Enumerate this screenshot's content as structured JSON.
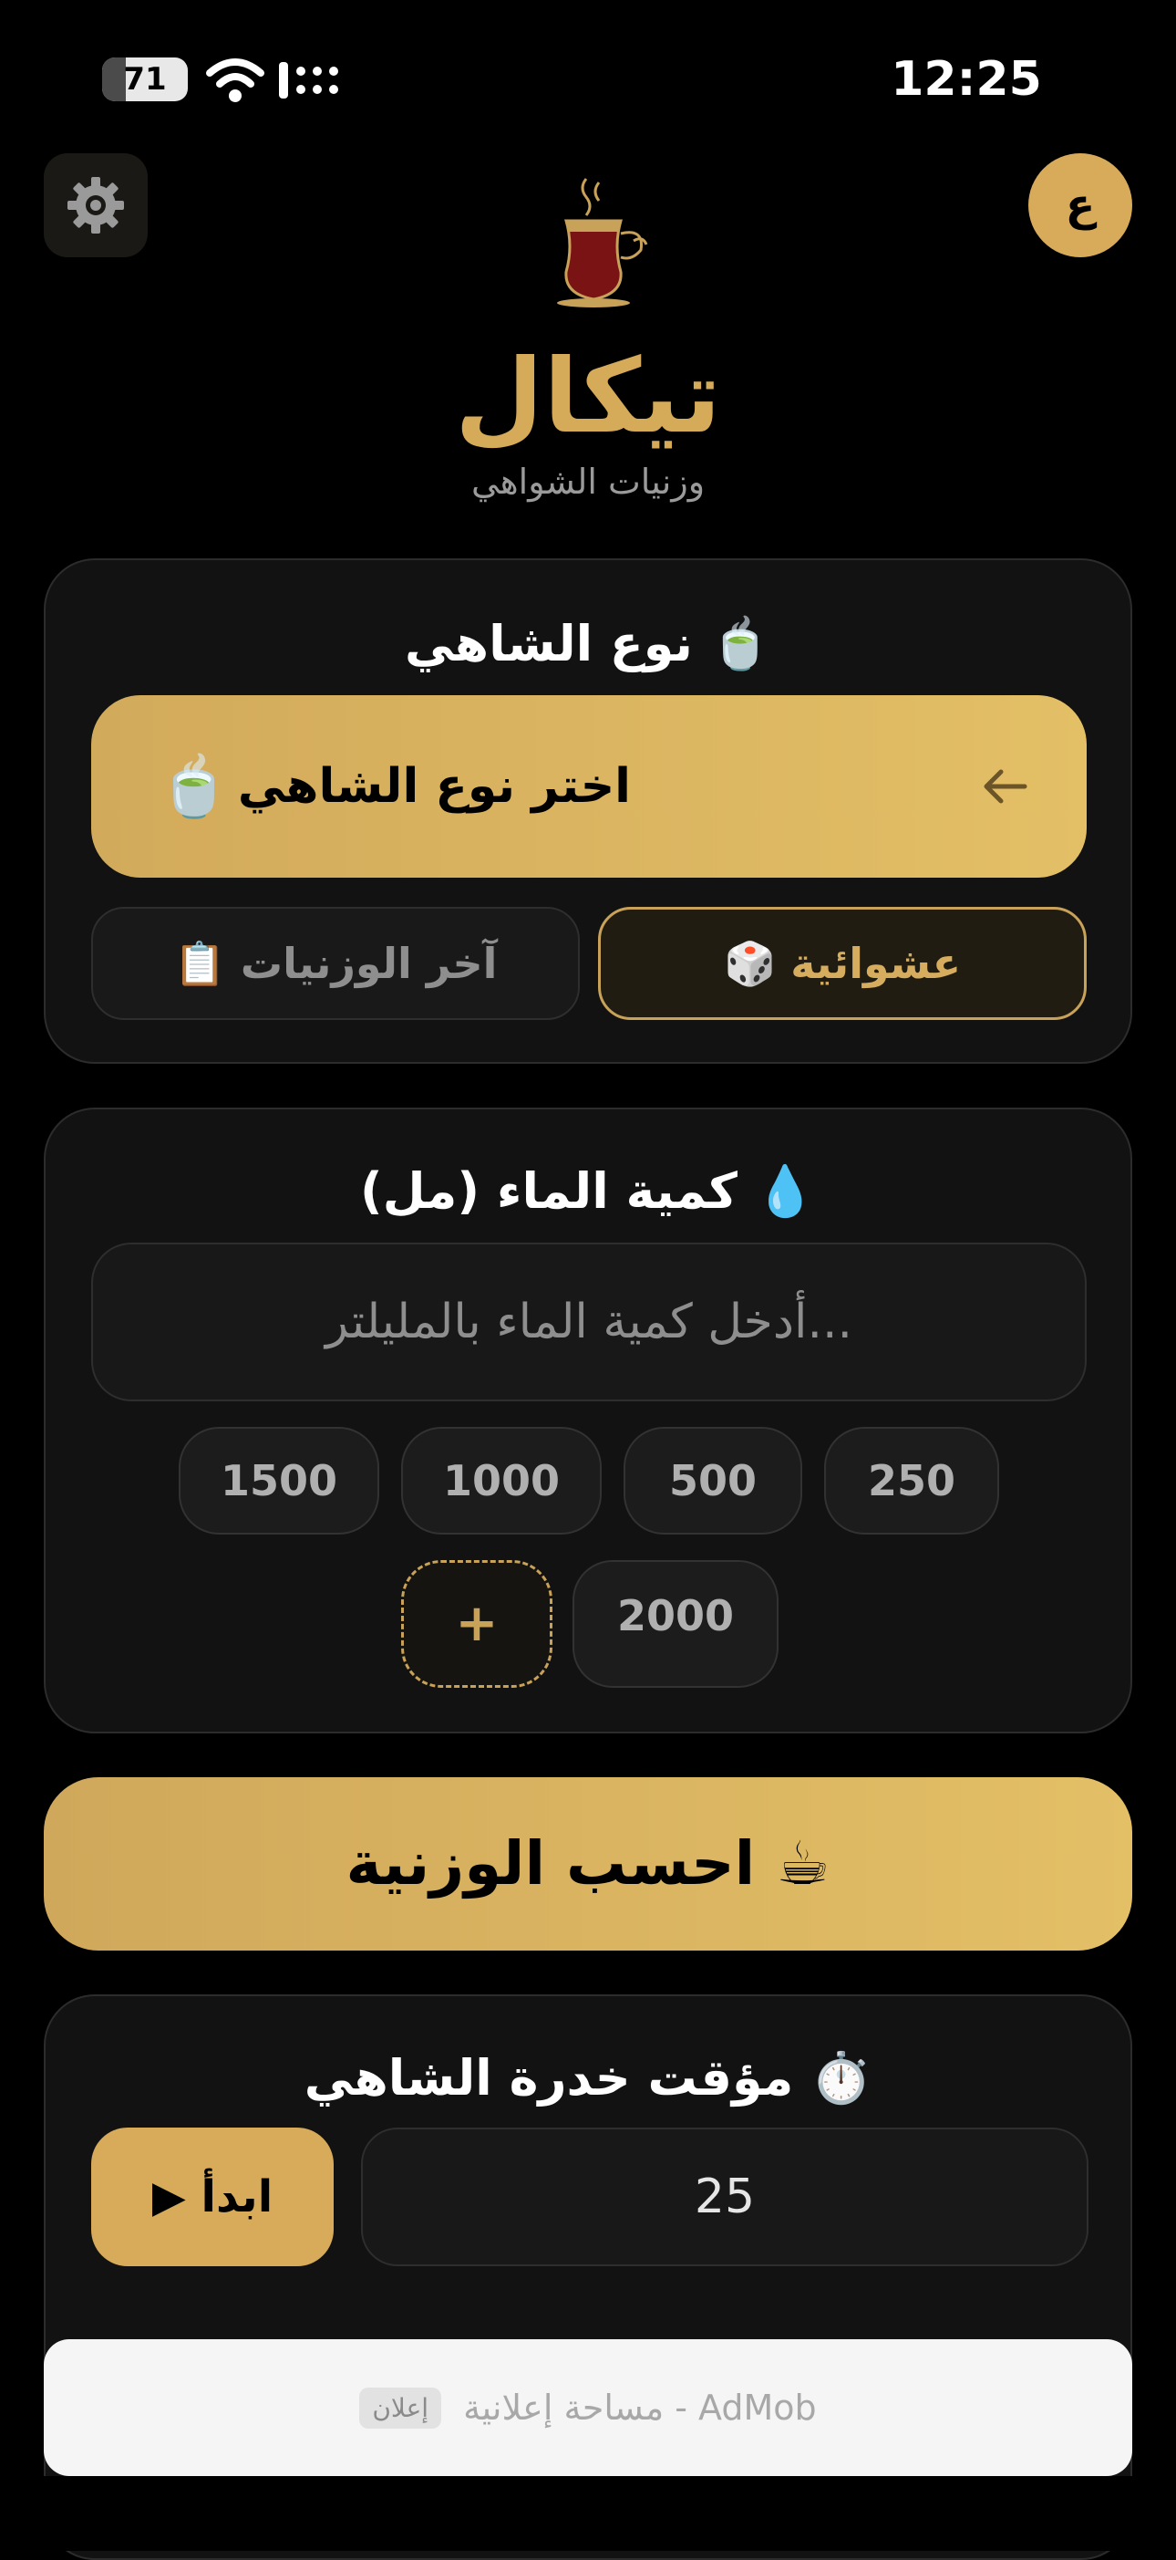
{
  "status_bar": {
    "time": "12:25",
    "battery": "71"
  },
  "header": {
    "settings_icon": "gear-icon",
    "lang_label": "ع",
    "title": "تيكال",
    "subtitle": "وزنيات الشواهي"
  },
  "tea_section": {
    "title": "نوع الشاهي 🍵",
    "select_label": "اختر نوع الشاهي",
    "select_emoji": "🍵",
    "random_label": "🎲 عشوائية",
    "history_label": "📋 آخر الوزنيات"
  },
  "water_section": {
    "title": "كمية الماء (مل) 💧",
    "placeholder": "أدخل كمية الماء بالمليلتر...",
    "presets": [
      "250",
      "500",
      "1000",
      "1500",
      "2000"
    ],
    "add_label": "+"
  },
  "calc_button": {
    "label": "احسب الوزنية ☕"
  },
  "timer_section": {
    "title": "مؤقت خدرة الشاهي ⏱️",
    "value": "25",
    "start_label": "▶ ابدأ"
  },
  "ad": {
    "text": "مساحة إعلانية - AdMob",
    "badge": "إعلان"
  },
  "colors": {
    "accent": "#d7ab5a",
    "background": "#000000",
    "card": "#121212"
  }
}
